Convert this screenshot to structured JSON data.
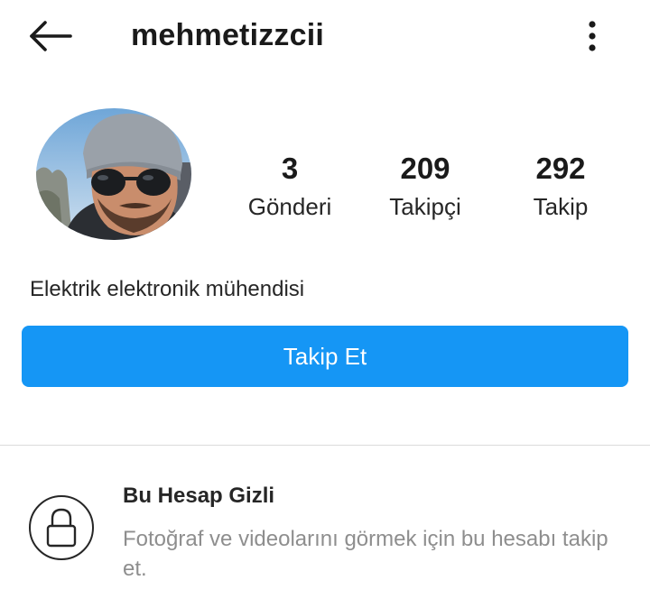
{
  "header": {
    "back_icon": "arrow-left-icon",
    "username": "mehmetizzcii",
    "more_icon": "more-vertical-icon"
  },
  "profile": {
    "avatar": "profile-photo",
    "stats": [
      {
        "value": "3",
        "label": "Gönderi"
      },
      {
        "value": "209",
        "label": "Takipçi"
      },
      {
        "value": "292",
        "label": "Takip"
      }
    ],
    "bio": "Elektrik elektronik mühendisi",
    "follow_button": "Takip Et"
  },
  "private_notice": {
    "icon": "lock-icon",
    "title": "Bu Hesap Gizli",
    "description": "Fotoğraf ve videolarını görmek için bu hesabı takip et."
  },
  "colors": {
    "accent": "#1596f5",
    "text": "#262626",
    "muted": "#8e8e8e",
    "divider": "#dbdbdb"
  }
}
